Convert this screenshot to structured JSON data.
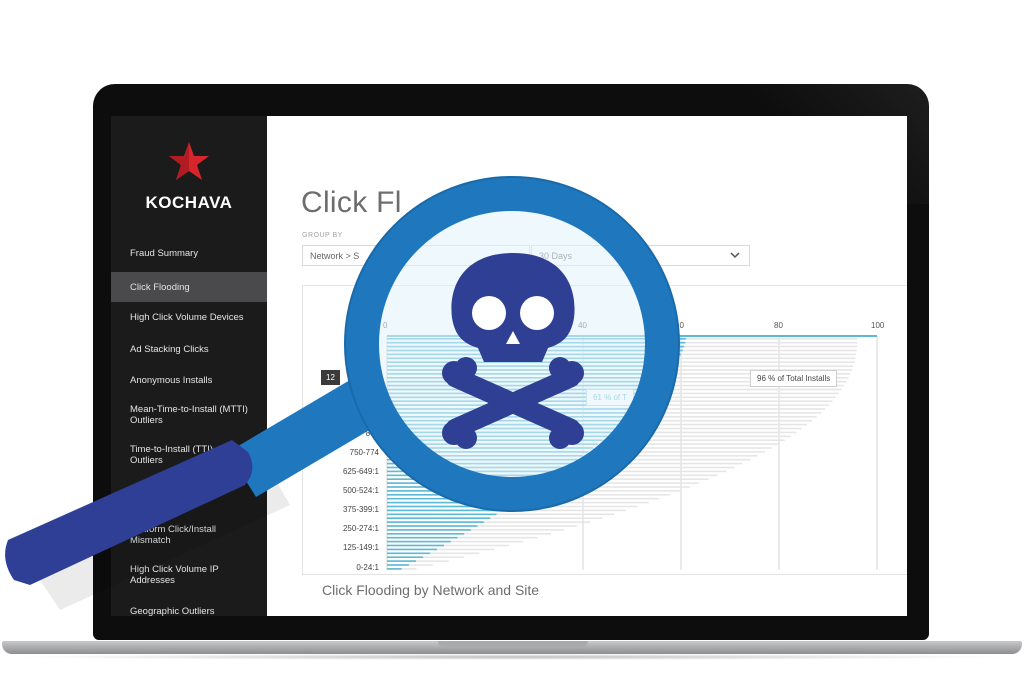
{
  "brand": {
    "name": "KOCHAVA",
    "logo_icon": "red-star-icon",
    "accent": "#d7262b"
  },
  "sidebar": {
    "items": [
      {
        "label": "Fraud Summary",
        "active": false
      },
      {
        "label": "Click Flooding",
        "active": true
      },
      {
        "label": "High Click Volume Devices",
        "active": false
      },
      {
        "label": "Ad Stacking Clicks",
        "active": false
      },
      {
        "label": "Anonymous Installs",
        "active": false
      },
      {
        "label": "Mean-Time-to-Install (MTTI) Outliers",
        "active": false
      },
      {
        "label": "Time-to-Install (TTI) Outliers",
        "active": false
      },
      {
        "label": "Platform Click/Install Mismatch",
        "active": false
      },
      {
        "label": "High Click Volume IP Addresses",
        "active": false
      },
      {
        "label": "Geographic Outliers",
        "active": false
      }
    ]
  },
  "main": {
    "title": "Click Fl",
    "group_by": {
      "label": "GROUP BY",
      "value": "Network > S"
    },
    "period": {
      "value": "30 Days"
    },
    "section_title": "Click Flooding by Network and Site"
  },
  "chart_data": {
    "type": "bar",
    "orientation": "horizontal",
    "x_ticks": [
      "0",
      "40",
      "60",
      "80",
      "100"
    ],
    "xlim": [
      0,
      100
    ],
    "y_tick_labels": [
      "0-24:1",
      "125-149:1",
      "250-274:1",
      "375-399:1",
      "500-524:1",
      "625-649:1",
      "750-774",
      "875"
    ],
    "annotations": [
      "96 % of Total Installs",
      "61 % of T",
      "12"
    ],
    "series": [
      {
        "color": "#5bbad5"
      },
      {
        "color": "#e6e6e6"
      }
    ]
  },
  "overlay": {
    "icon": "skull-and-crossbones-icon",
    "magnifier_icon": "magnifying-glass-icon",
    "ring_color": "#1f77bd",
    "handle_color": "#2f3f96"
  }
}
